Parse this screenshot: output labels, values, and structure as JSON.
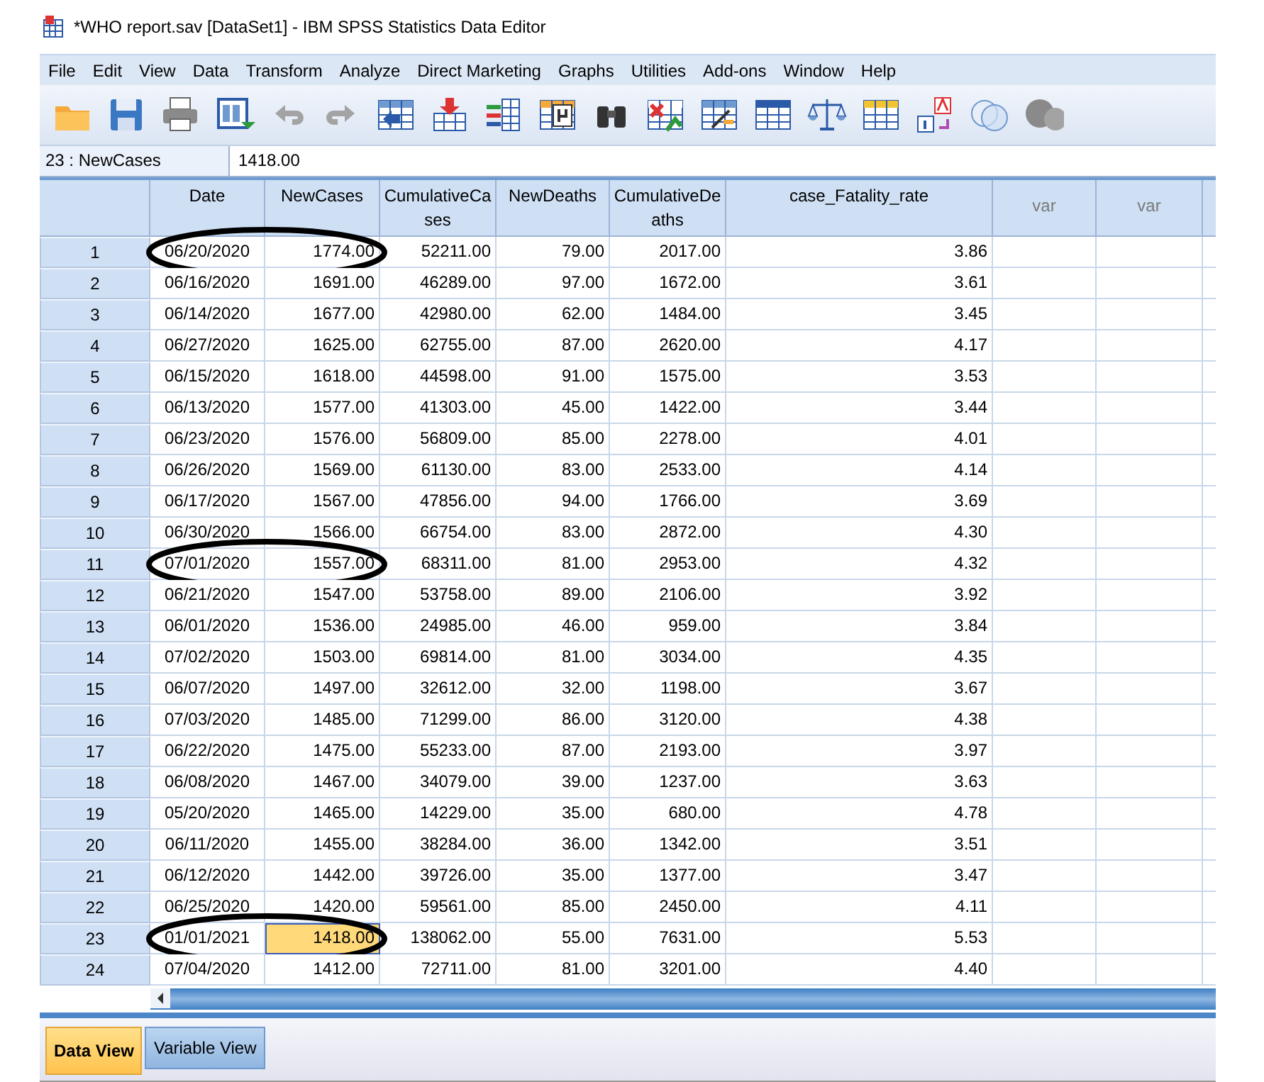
{
  "window": {
    "title": "*WHO report.sav [DataSet1] - IBM SPSS Statistics Data Editor"
  },
  "menu": [
    "File",
    "Edit",
    "View",
    "Data",
    "Transform",
    "Analyze",
    "Direct Marketing",
    "Graphs",
    "Utilities",
    "Add-ons",
    "Window",
    "Help"
  ],
  "cell_reference": {
    "name": "23 : NewCases",
    "value": "1418.00"
  },
  "table": {
    "columns": [
      {
        "label": "Date",
        "kind": "variable"
      },
      {
        "label": "NewCases",
        "kind": "variable"
      },
      {
        "label": "CumulativeCa ses",
        "kind": "variable"
      },
      {
        "label": "NewDeaths",
        "kind": "variable"
      },
      {
        "label": "CumulativeDe aths",
        "kind": "variable"
      },
      {
        "label": "case_Fatality_rate",
        "kind": "variable"
      },
      {
        "label": "var",
        "kind": "empty"
      },
      {
        "label": "var",
        "kind": "empty"
      }
    ],
    "rows": [
      {
        "number": "1",
        "circled": true,
        "cells": [
          {
            "text": "06/20/2020",
            "selected": false
          },
          {
            "text": "1774.00",
            "selected": false
          },
          {
            "text": "52211.00",
            "selected": false
          },
          {
            "text": "79.00",
            "selected": false
          },
          {
            "text": "2017.00",
            "selected": false
          },
          {
            "text": "3.86",
            "selected": false
          }
        ]
      },
      {
        "number": "2",
        "circled": false,
        "cells": [
          {
            "text": "06/16/2020",
            "selected": false
          },
          {
            "text": "1691.00",
            "selected": false
          },
          {
            "text": "46289.00",
            "selected": false
          },
          {
            "text": "97.00",
            "selected": false
          },
          {
            "text": "1672.00",
            "selected": false
          },
          {
            "text": "3.61",
            "selected": false
          }
        ]
      },
      {
        "number": "3",
        "circled": false,
        "cells": [
          {
            "text": "06/14/2020",
            "selected": false
          },
          {
            "text": "1677.00",
            "selected": false
          },
          {
            "text": "42980.00",
            "selected": false
          },
          {
            "text": "62.00",
            "selected": false
          },
          {
            "text": "1484.00",
            "selected": false
          },
          {
            "text": "3.45",
            "selected": false
          }
        ]
      },
      {
        "number": "4",
        "circled": false,
        "cells": [
          {
            "text": "06/27/2020",
            "selected": false
          },
          {
            "text": "1625.00",
            "selected": false
          },
          {
            "text": "62755.00",
            "selected": false
          },
          {
            "text": "87.00",
            "selected": false
          },
          {
            "text": "2620.00",
            "selected": false
          },
          {
            "text": "4.17",
            "selected": false
          }
        ]
      },
      {
        "number": "5",
        "circled": false,
        "cells": [
          {
            "text": "06/15/2020",
            "selected": false
          },
          {
            "text": "1618.00",
            "selected": false
          },
          {
            "text": "44598.00",
            "selected": false
          },
          {
            "text": "91.00",
            "selected": false
          },
          {
            "text": "1575.00",
            "selected": false
          },
          {
            "text": "3.53",
            "selected": false
          }
        ]
      },
      {
        "number": "6",
        "circled": false,
        "cells": [
          {
            "text": "06/13/2020",
            "selected": false
          },
          {
            "text": "1577.00",
            "selected": false
          },
          {
            "text": "41303.00",
            "selected": false
          },
          {
            "text": "45.00",
            "selected": false
          },
          {
            "text": "1422.00",
            "selected": false
          },
          {
            "text": "3.44",
            "selected": false
          }
        ]
      },
      {
        "number": "7",
        "circled": false,
        "cells": [
          {
            "text": "06/23/2020",
            "selected": false
          },
          {
            "text": "1576.00",
            "selected": false
          },
          {
            "text": "56809.00",
            "selected": false
          },
          {
            "text": "85.00",
            "selected": false
          },
          {
            "text": "2278.00",
            "selected": false
          },
          {
            "text": "4.01",
            "selected": false
          }
        ]
      },
      {
        "number": "8",
        "circled": false,
        "cells": [
          {
            "text": "06/26/2020",
            "selected": false
          },
          {
            "text": "1569.00",
            "selected": false
          },
          {
            "text": "61130.00",
            "selected": false
          },
          {
            "text": "83.00",
            "selected": false
          },
          {
            "text": "2533.00",
            "selected": false
          },
          {
            "text": "4.14",
            "selected": false
          }
        ]
      },
      {
        "number": "9",
        "circled": false,
        "cells": [
          {
            "text": "06/17/2020",
            "selected": false
          },
          {
            "text": "1567.00",
            "selected": false
          },
          {
            "text": "47856.00",
            "selected": false
          },
          {
            "text": "94.00",
            "selected": false
          },
          {
            "text": "1766.00",
            "selected": false
          },
          {
            "text": "3.69",
            "selected": false
          }
        ]
      },
      {
        "number": "10",
        "circled": false,
        "cells": [
          {
            "text": "06/30/2020",
            "selected": false
          },
          {
            "text": "1566.00",
            "selected": false
          },
          {
            "text": "66754.00",
            "selected": false
          },
          {
            "text": "83.00",
            "selected": false
          },
          {
            "text": "2872.00",
            "selected": false
          },
          {
            "text": "4.30",
            "selected": false
          }
        ]
      },
      {
        "number": "11",
        "circled": true,
        "cells": [
          {
            "text": "07/01/2020",
            "selected": false
          },
          {
            "text": "1557.00",
            "selected": false
          },
          {
            "text": "68311.00",
            "selected": false
          },
          {
            "text": "81.00",
            "selected": false
          },
          {
            "text": "2953.00",
            "selected": false
          },
          {
            "text": "4.32",
            "selected": false
          }
        ]
      },
      {
        "number": "12",
        "circled": false,
        "cells": [
          {
            "text": "06/21/2020",
            "selected": false
          },
          {
            "text": "1547.00",
            "selected": false
          },
          {
            "text": "53758.00",
            "selected": false
          },
          {
            "text": "89.00",
            "selected": false
          },
          {
            "text": "2106.00",
            "selected": false
          },
          {
            "text": "3.92",
            "selected": false
          }
        ]
      },
      {
        "number": "13",
        "circled": false,
        "cells": [
          {
            "text": "06/01/2020",
            "selected": false
          },
          {
            "text": "1536.00",
            "selected": false
          },
          {
            "text": "24985.00",
            "selected": false
          },
          {
            "text": "46.00",
            "selected": false
          },
          {
            "text": "959.00",
            "selected": false
          },
          {
            "text": "3.84",
            "selected": false
          }
        ]
      },
      {
        "number": "14",
        "circled": false,
        "cells": [
          {
            "text": "07/02/2020",
            "selected": false
          },
          {
            "text": "1503.00",
            "selected": false
          },
          {
            "text": "69814.00",
            "selected": false
          },
          {
            "text": "81.00",
            "selected": false
          },
          {
            "text": "3034.00",
            "selected": false
          },
          {
            "text": "4.35",
            "selected": false
          }
        ]
      },
      {
        "number": "15",
        "circled": false,
        "cells": [
          {
            "text": "06/07/2020",
            "selected": false
          },
          {
            "text": "1497.00",
            "selected": false
          },
          {
            "text": "32612.00",
            "selected": false
          },
          {
            "text": "32.00",
            "selected": false
          },
          {
            "text": "1198.00",
            "selected": false
          },
          {
            "text": "3.67",
            "selected": false
          }
        ]
      },
      {
        "number": "16",
        "circled": false,
        "cells": [
          {
            "text": "07/03/2020",
            "selected": false
          },
          {
            "text": "1485.00",
            "selected": false
          },
          {
            "text": "71299.00",
            "selected": false
          },
          {
            "text": "86.00",
            "selected": false
          },
          {
            "text": "3120.00",
            "selected": false
          },
          {
            "text": "4.38",
            "selected": false
          }
        ]
      },
      {
        "number": "17",
        "circled": false,
        "cells": [
          {
            "text": "06/22/2020",
            "selected": false
          },
          {
            "text": "1475.00",
            "selected": false
          },
          {
            "text": "55233.00",
            "selected": false
          },
          {
            "text": "87.00",
            "selected": false
          },
          {
            "text": "2193.00",
            "selected": false
          },
          {
            "text": "3.97",
            "selected": false
          }
        ]
      },
      {
        "number": "18",
        "circled": false,
        "cells": [
          {
            "text": "06/08/2020",
            "selected": false
          },
          {
            "text": "1467.00",
            "selected": false
          },
          {
            "text": "34079.00",
            "selected": false
          },
          {
            "text": "39.00",
            "selected": false
          },
          {
            "text": "1237.00",
            "selected": false
          },
          {
            "text": "3.63",
            "selected": false
          }
        ]
      },
      {
        "number": "19",
        "circled": false,
        "cells": [
          {
            "text": "05/20/2020",
            "selected": false
          },
          {
            "text": "1465.00",
            "selected": false
          },
          {
            "text": "14229.00",
            "selected": false
          },
          {
            "text": "35.00",
            "selected": false
          },
          {
            "text": "680.00",
            "selected": false
          },
          {
            "text": "4.78",
            "selected": false
          }
        ]
      },
      {
        "number": "20",
        "circled": false,
        "cells": [
          {
            "text": "06/11/2020",
            "selected": false
          },
          {
            "text": "1455.00",
            "selected": false
          },
          {
            "text": "38284.00",
            "selected": false
          },
          {
            "text": "36.00",
            "selected": false
          },
          {
            "text": "1342.00",
            "selected": false
          },
          {
            "text": "3.51",
            "selected": false
          }
        ]
      },
      {
        "number": "21",
        "circled": false,
        "cells": [
          {
            "text": "06/12/2020",
            "selected": false
          },
          {
            "text": "1442.00",
            "selected": false
          },
          {
            "text": "39726.00",
            "selected": false
          },
          {
            "text": "35.00",
            "selected": false
          },
          {
            "text": "1377.00",
            "selected": false
          },
          {
            "text": "3.47",
            "selected": false
          }
        ]
      },
      {
        "number": "22",
        "circled": false,
        "cells": [
          {
            "text": "06/25/2020",
            "selected": false
          },
          {
            "text": "1420.00",
            "selected": false
          },
          {
            "text": "59561.00",
            "selected": false
          },
          {
            "text": "85.00",
            "selected": false
          },
          {
            "text": "2450.00",
            "selected": false
          },
          {
            "text": "4.11",
            "selected": false
          }
        ]
      },
      {
        "number": "23",
        "circled": true,
        "cells": [
          {
            "text": "01/01/2021",
            "selected": false
          },
          {
            "text": "1418.00",
            "selected": true
          },
          {
            "text": "138062.00",
            "selected": false
          },
          {
            "text": "55.00",
            "selected": false
          },
          {
            "text": "7631.00",
            "selected": false
          },
          {
            "text": "5.53",
            "selected": false
          }
        ]
      },
      {
        "number": "24",
        "circled": false,
        "cells": [
          {
            "text": "07/04/2020",
            "selected": false
          },
          {
            "text": "1412.00",
            "selected": false
          },
          {
            "text": "72711.00",
            "selected": false
          },
          {
            "text": "81.00",
            "selected": false
          },
          {
            "text": "3201.00",
            "selected": false
          },
          {
            "text": "4.40",
            "selected": false
          }
        ]
      }
    ]
  },
  "view_tabs": [
    {
      "label": "Data View",
      "selected": true
    },
    {
      "label": "Variable View",
      "selected": false
    }
  ]
}
